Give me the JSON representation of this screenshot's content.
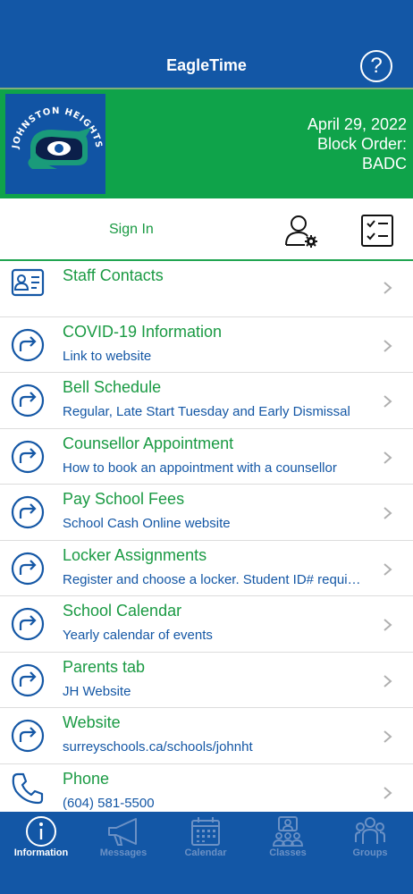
{
  "header": {
    "title": "EagleTime",
    "help_icon": "help-circle-icon"
  },
  "banner": {
    "logo_text": "JOHNSTON HEIGHTS",
    "date": "April 29, 2022",
    "block_label": "Block Order:",
    "block_order": "BADC"
  },
  "account": {
    "sign_in_label": "Sign In",
    "profile_icon": "user-settings-icon",
    "checklist_icon": "checklist-icon"
  },
  "list": [
    {
      "title": "Staff Contacts",
      "subtitle": "",
      "icon": "contact-card-icon"
    },
    {
      "title": "COVID-19 Information",
      "subtitle": "Link to website",
      "icon": "share-arrow-icon"
    },
    {
      "title": "Bell Schedule",
      "subtitle": "Regular, Late Start Tuesday and Early Dismissal",
      "icon": "share-arrow-icon"
    },
    {
      "title": "Counsellor Appointment",
      "subtitle": "How to book an appointment with a counsellor",
      "icon": "share-arrow-icon"
    },
    {
      "title": "Pay School Fees",
      "subtitle": "School Cash Online website",
      "icon": "share-arrow-icon"
    },
    {
      "title": "Locker Assignments",
      "subtitle": "Register and choose a locker. Student ID# requi…",
      "icon": "share-arrow-icon"
    },
    {
      "title": "School Calendar",
      "subtitle": "Yearly calendar of events",
      "icon": "share-arrow-icon"
    },
    {
      "title": "Parents tab",
      "subtitle": "JH Website",
      "icon": "share-arrow-icon"
    },
    {
      "title": "Website",
      "subtitle": "surreyschools.ca/schools/johnht",
      "icon": "share-arrow-icon"
    },
    {
      "title": "Phone",
      "subtitle": "(604) 581-5500",
      "icon": "phone-icon"
    }
  ],
  "tabs": [
    {
      "label": "Information",
      "icon": "info-icon",
      "active": true
    },
    {
      "label": "Messages",
      "icon": "megaphone-icon",
      "active": false
    },
    {
      "label": "Calendar",
      "icon": "calendar-icon",
      "active": false
    },
    {
      "label": "Classes",
      "icon": "classes-icon",
      "active": false
    },
    {
      "label": "Groups",
      "icon": "groups-icon",
      "active": false
    }
  ],
  "colors": {
    "brand_blue": "#1357a6",
    "brand_green": "#0fa34a",
    "link_green": "#1a9a43",
    "text_blue": "#1457a5"
  }
}
